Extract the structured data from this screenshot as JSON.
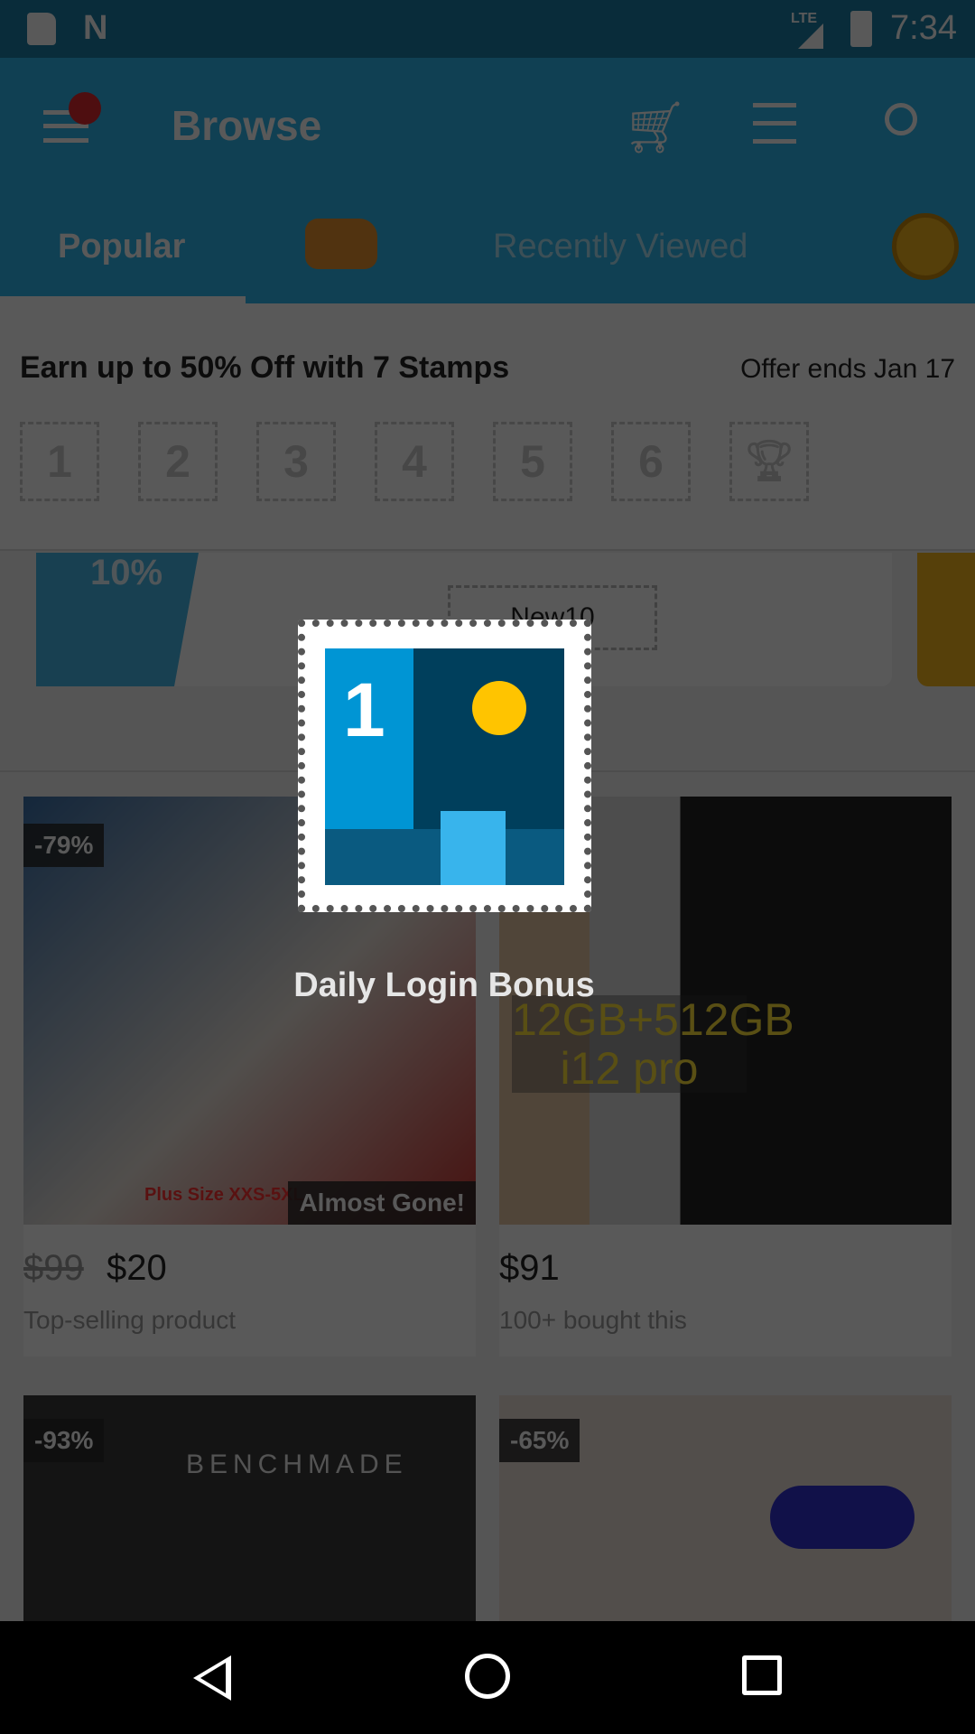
{
  "status_bar": {
    "time": "7:34",
    "network": "LTE",
    "icons": [
      "sd-card-icon",
      "n-notification-icon",
      "signal-icon",
      "battery-charging-icon"
    ]
  },
  "app_bar": {
    "title": "Browse",
    "icons": [
      "menu-icon",
      "cart-icon",
      "filter-icon",
      "search-icon"
    ],
    "accent": "#2fb7ec"
  },
  "tabs": [
    {
      "label": "Popular",
      "selected": true
    },
    {
      "label": "",
      "icon": "delivery-truck-icon"
    },
    {
      "label": "Recently Viewed"
    },
    {
      "label": "",
      "icon": "wheel-icon"
    }
  ],
  "stamps": {
    "title": "Earn up to 50% Off with 7 Stamps",
    "offer": "Offer ends Jan 17",
    "boxes": [
      "1",
      "2",
      "3",
      "4",
      "5",
      "6"
    ],
    "final_icon": "trophy-icon"
  },
  "banner": {
    "discount": "10%",
    "code": "New10"
  },
  "products": [
    {
      "badge": "-79%",
      "tag": "Almost Gone!",
      "old_price": "$99",
      "price": "$20",
      "subtitle": "Top-selling product",
      "image_text": "Plus Size XXS-5XL"
    },
    {
      "price": "$91",
      "subtitle": "100+ bought this",
      "image_text": "12GB+512GB i12 pro"
    },
    {
      "badge": "-93%",
      "image_text": "BENCHMADE"
    },
    {
      "badge": "-65%"
    }
  ],
  "modal": {
    "stamp_number": "1",
    "label": "Daily Login Bonus"
  }
}
